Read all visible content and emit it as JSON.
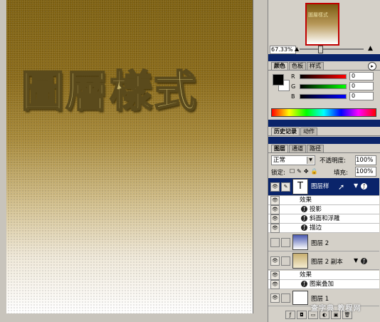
{
  "canvas": {
    "art_text": "圖層樣式"
  },
  "navigator": {
    "thumb_text": "圖層樣式",
    "zoom": "67.33%"
  },
  "color_panel": {
    "tabs": [
      "颜色",
      "色板",
      "样式"
    ],
    "sliders": [
      {
        "label": "R",
        "value": "0"
      },
      {
        "label": "G",
        "value": "0"
      },
      {
        "label": "B",
        "value": "0"
      }
    ]
  },
  "history_panel": {
    "tabs": [
      "历史记录",
      "动作"
    ]
  },
  "layers_panel": {
    "tabs": [
      "图层",
      "通道",
      "路径"
    ],
    "blend_mode": "正常",
    "opacity_label": "不透明度:",
    "opacity": "100%",
    "lock_label": "锁定:",
    "fill_label": "填充:",
    "fill": "100%",
    "layers": [
      {
        "name": "图层样",
        "type_icon": "T",
        "effects_label": "效果",
        "effects": [
          "投影",
          "斜面和浮雕",
          "描边"
        ]
      },
      {
        "name": "图层 2"
      },
      {
        "name": "图层 2 副本",
        "effects_label": "效果",
        "effects": [
          "图案叠加"
        ]
      },
      {
        "name": "图层 1"
      }
    ]
  },
  "watermark": "查字典 教程网"
}
